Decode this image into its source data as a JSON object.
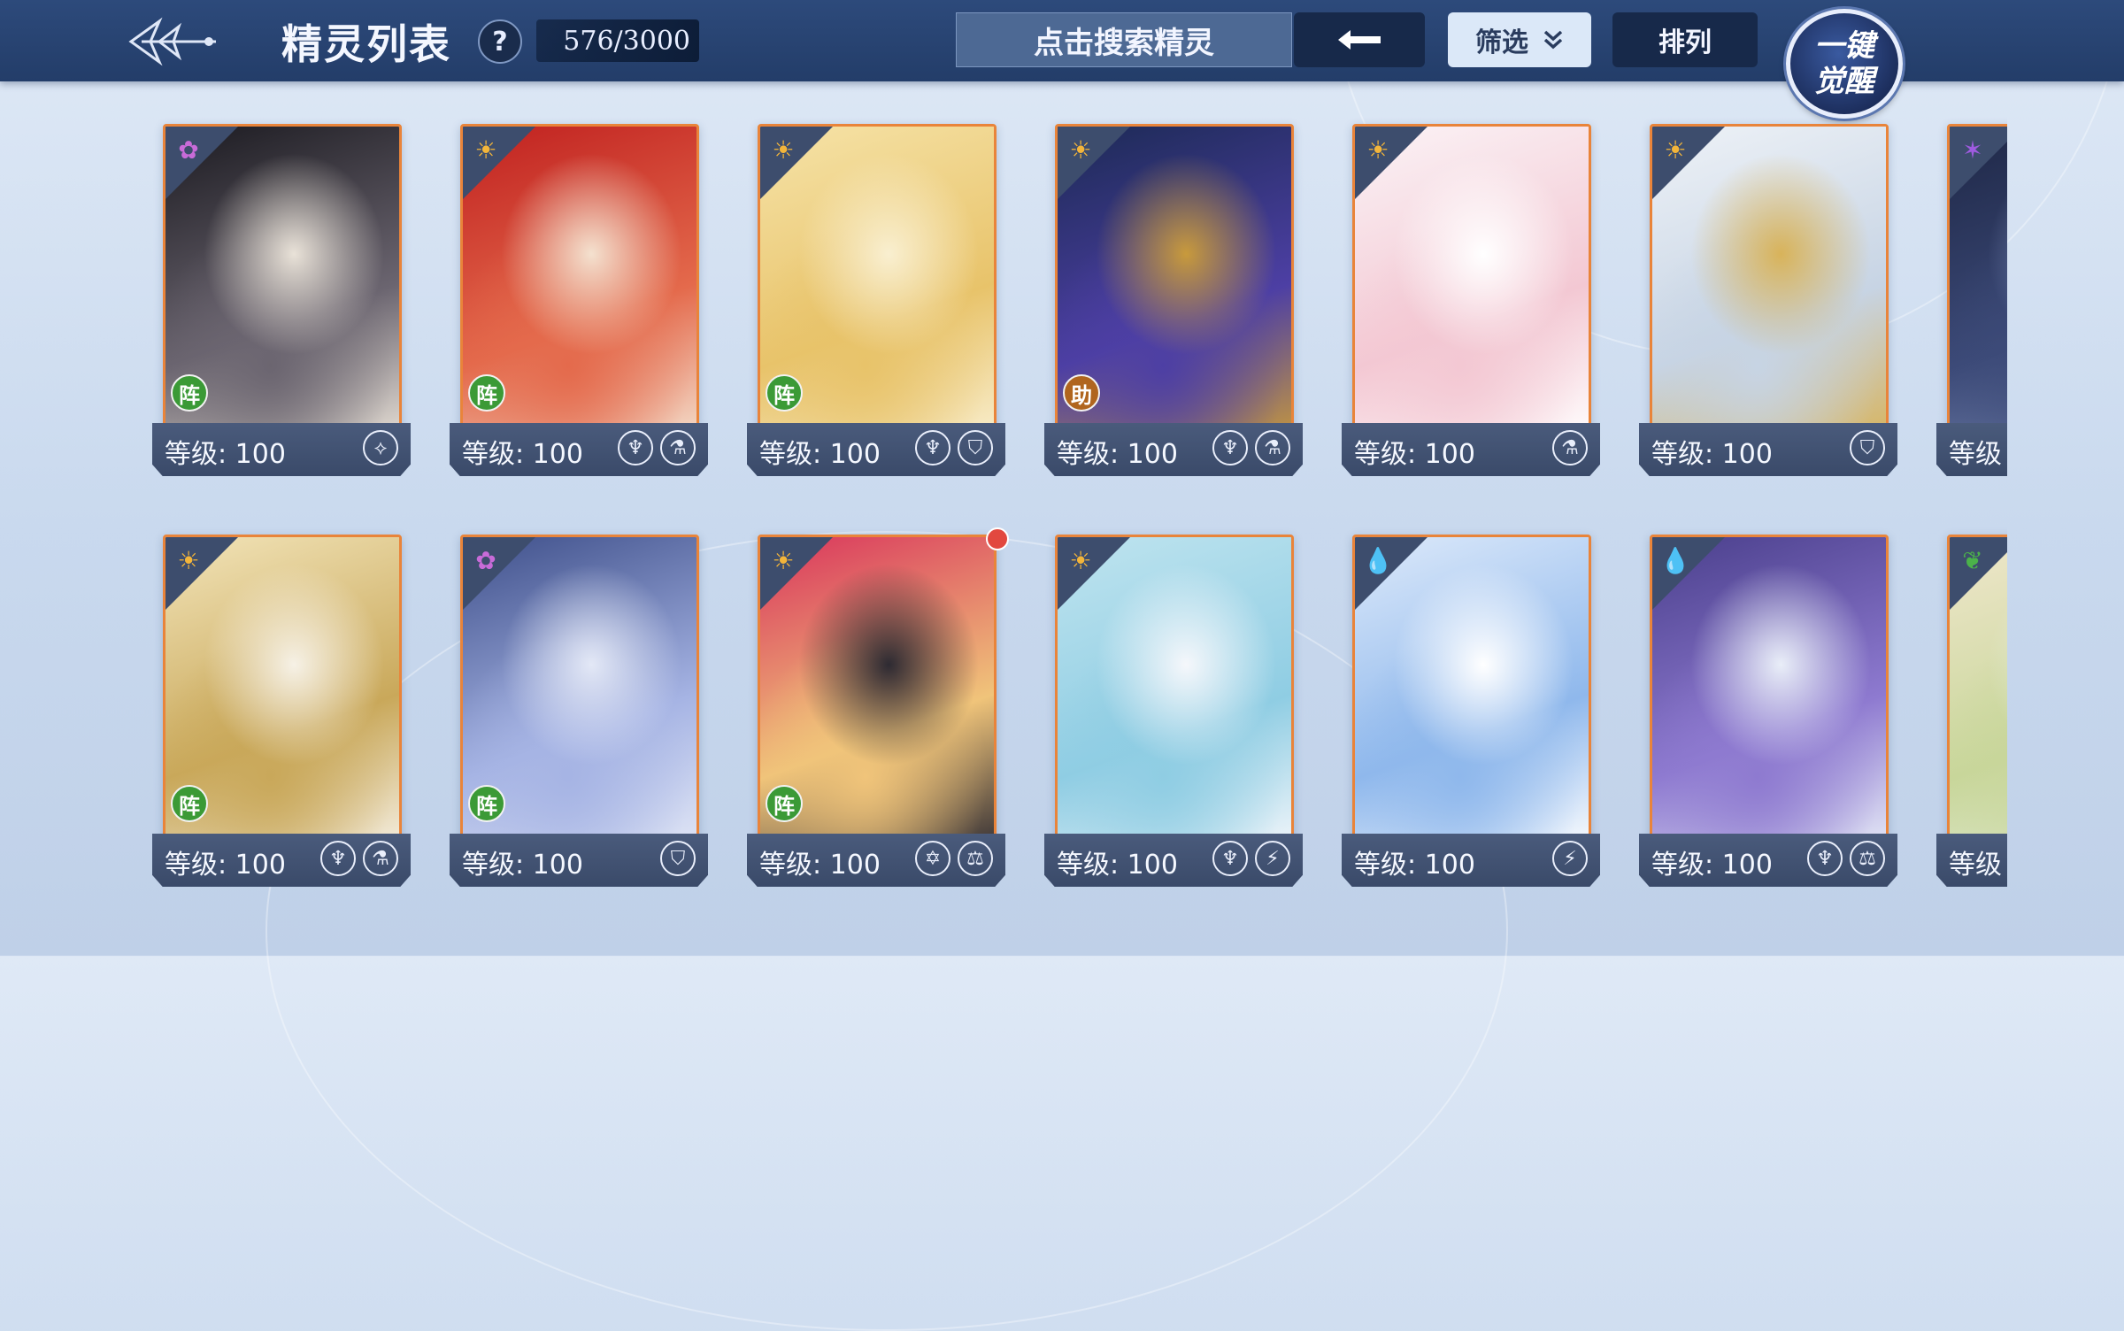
{
  "header": {
    "title": "精灵列表",
    "help_label": "?",
    "count": "576/3000",
    "search_placeholder": "点击搜索精灵",
    "back_icon": "←",
    "filter_label": "筛选",
    "filter_icon": "chevron-down-double",
    "sort_label": "排列",
    "awaken_line1": "一键",
    "awaken_line2": "觉醒"
  },
  "level_prefix": "等级: 100",
  "colors": {
    "frame_orange": "#e9843a",
    "topbar": "#233d69",
    "badge_green": "#3b9a36",
    "badge_brown": "#b0651e",
    "notice_red": "#e2483f"
  },
  "cards": [
    {
      "element": "flower",
      "element_glyph": "✿",
      "element_color": "#c86bd8",
      "role": "阵",
      "role_color": "#3b9a36",
      "level": "等级: 100",
      "skills": [
        "⟡"
      ],
      "art": [
        "#1b1a20",
        "#6b6570",
        "#e9e2d8"
      ]
    },
    {
      "element": "sun",
      "element_glyph": "☀",
      "element_color": "#f3b53a",
      "role": "阵",
      "role_color": "#3b9a36",
      "level": "等级: 100",
      "skills": [
        "♆",
        "⚗"
      ],
      "art": [
        "#c0201f",
        "#e46a4c",
        "#f4e1cf"
      ]
    },
    {
      "element": "sun",
      "element_glyph": "☀",
      "element_color": "#f3b53a",
      "role": "阵",
      "role_color": "#3b9a36",
      "level": "等级: 100",
      "skills": [
        "♆",
        "⛉"
      ],
      "art": [
        "#f6e3a8",
        "#e8c36a",
        "#f9efd0"
      ]
    },
    {
      "element": "sun",
      "element_glyph": "☀",
      "element_color": "#f3b53a",
      "role": "助",
      "role_color": "#b0651e",
      "level": "等级: 100",
      "skills": [
        "♆",
        "⚗"
      ],
      "art": [
        "#1c2a55",
        "#4d3fa4",
        "#c89a3c"
      ]
    },
    {
      "element": "sun",
      "element_glyph": "☀",
      "element_color": "#f3b53a",
      "role": "",
      "role_color": "",
      "level": "等级: 100",
      "skills": [
        "⚗"
      ],
      "art": [
        "#fbf3f6",
        "#f3c8d3",
        "#ffffff"
      ]
    },
    {
      "element": "sun",
      "element_glyph": "☀",
      "element_color": "#f3b53a",
      "role": "",
      "role_color": "",
      "level": "等级: 100",
      "skills": [
        "⛉"
      ],
      "art": [
        "#eef2f7",
        "#c7d4e4",
        "#d8b35a"
      ]
    },
    {
      "element": "spirit",
      "element_glyph": "✶",
      "element_color": "#9f5be0",
      "role": "",
      "role_color": "",
      "level": "等级",
      "skills": [],
      "art": [
        "#1e2746",
        "#3c4a78",
        "#7f8fb8"
      ]
    },
    {
      "element": "sun",
      "element_glyph": "☀",
      "element_color": "#f3b53a",
      "role": "阵",
      "role_color": "#3b9a36",
      "level": "等级: 100",
      "skills": [
        "♆",
        "⚗"
      ],
      "art": [
        "#f2e4b9",
        "#c9a85a",
        "#f6f1e6"
      ]
    },
    {
      "element": "flower",
      "element_glyph": "✿",
      "element_color": "#c86bd8",
      "role": "阵",
      "role_color": "#3b9a36",
      "level": "等级: 100",
      "skills": [
        "⛉"
      ],
      "art": [
        "#3e4f8a",
        "#a6b4e4",
        "#e3e8f6"
      ]
    },
    {
      "element": "sun",
      "element_glyph": "☀",
      "element_color": "#f3b53a",
      "role": "阵",
      "role_color": "#3b9a36",
      "level": "等级: 100",
      "skills": [
        "✡",
        "⚖"
      ],
      "art": [
        "#d9345c",
        "#f0c47a",
        "#2d2a32"
      ],
      "notice": true
    },
    {
      "element": "sun",
      "element_glyph": "☀",
      "element_color": "#f3b53a",
      "role": "",
      "role_color": "",
      "level": "等级: 100",
      "skills": [
        "♆",
        "⚡"
      ],
      "art": [
        "#bfe4ef",
        "#8fcde3",
        "#f5f7fb"
      ]
    },
    {
      "element": "water",
      "element_glyph": "💧",
      "element_color": "#3a8be0",
      "role": "",
      "role_color": "",
      "level": "等级: 100",
      "skills": [
        "⚡"
      ],
      "art": [
        "#dce9fa",
        "#8fb8ec",
        "#ffffff"
      ]
    },
    {
      "element": "water",
      "element_glyph": "💧",
      "element_color": "#3a8be0",
      "role": "",
      "role_color": "",
      "level": "等级: 100",
      "skills": [
        "♆",
        "⚖"
      ],
      "art": [
        "#4a3f8c",
        "#8e7ad0",
        "#e9eef8"
      ]
    },
    {
      "element": "grass",
      "element_glyph": "❦",
      "element_color": "#4bb24a",
      "role": "",
      "role_color": "",
      "level": "等级",
      "skills": [],
      "art": [
        "#f0e7cc",
        "#c8d69a",
        "#e7efe1"
      ]
    }
  ]
}
